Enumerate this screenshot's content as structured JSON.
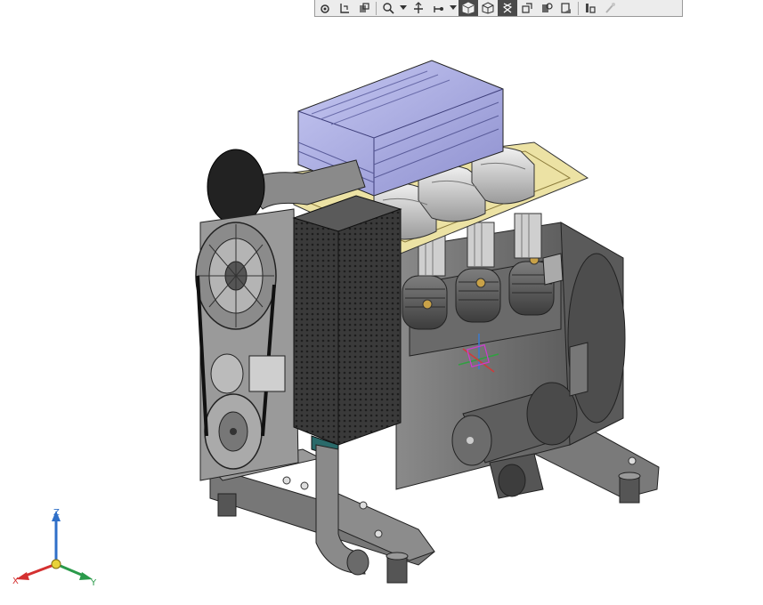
{
  "toolbar": {
    "buttons": [
      {
        "icon": "view-settings-icon",
        "active": false
      },
      {
        "icon": "previous-view-icon",
        "active": false
      },
      {
        "icon": "section-view-icon",
        "active": false
      },
      {
        "icon": "zoom-to-area-icon",
        "active": false
      },
      {
        "icon": "dropdown-arrow-icon",
        "active": false
      },
      {
        "icon": "view-orientation-icon",
        "active": false
      },
      {
        "icon": "display-style-icon",
        "active": false
      },
      {
        "icon": "dropdown-arrow-icon",
        "active": false
      },
      {
        "icon": "shaded-with-edges-icon",
        "active": true
      },
      {
        "icon": "hidden-lines-removed-icon",
        "active": false
      },
      {
        "icon": "wireframe-icon",
        "active": true
      },
      {
        "icon": "hide-show-items-icon",
        "active": false
      },
      {
        "icon": "edit-appearance-icon",
        "active": false
      },
      {
        "icon": "apply-scene-icon",
        "active": false
      },
      {
        "icon": "view-setting-icon",
        "active": false
      },
      {
        "icon": "realview-icon",
        "active": false
      }
    ]
  },
  "colors": {
    "engine_body": "#6f6f6f",
    "engine_dark": "#2b2b2b",
    "air_filter": "#a9abe0",
    "gasket": "#ece2a4",
    "heat_exchanger": "#3a3a3a",
    "valve_cover": "#d8d8d8"
  },
  "triad": {
    "x_label": "X",
    "y_label": "Y",
    "z_label": "Z",
    "x_color": "#d43030",
    "y_color": "#2a9a4a",
    "z_color": "#2f6fc8"
  }
}
